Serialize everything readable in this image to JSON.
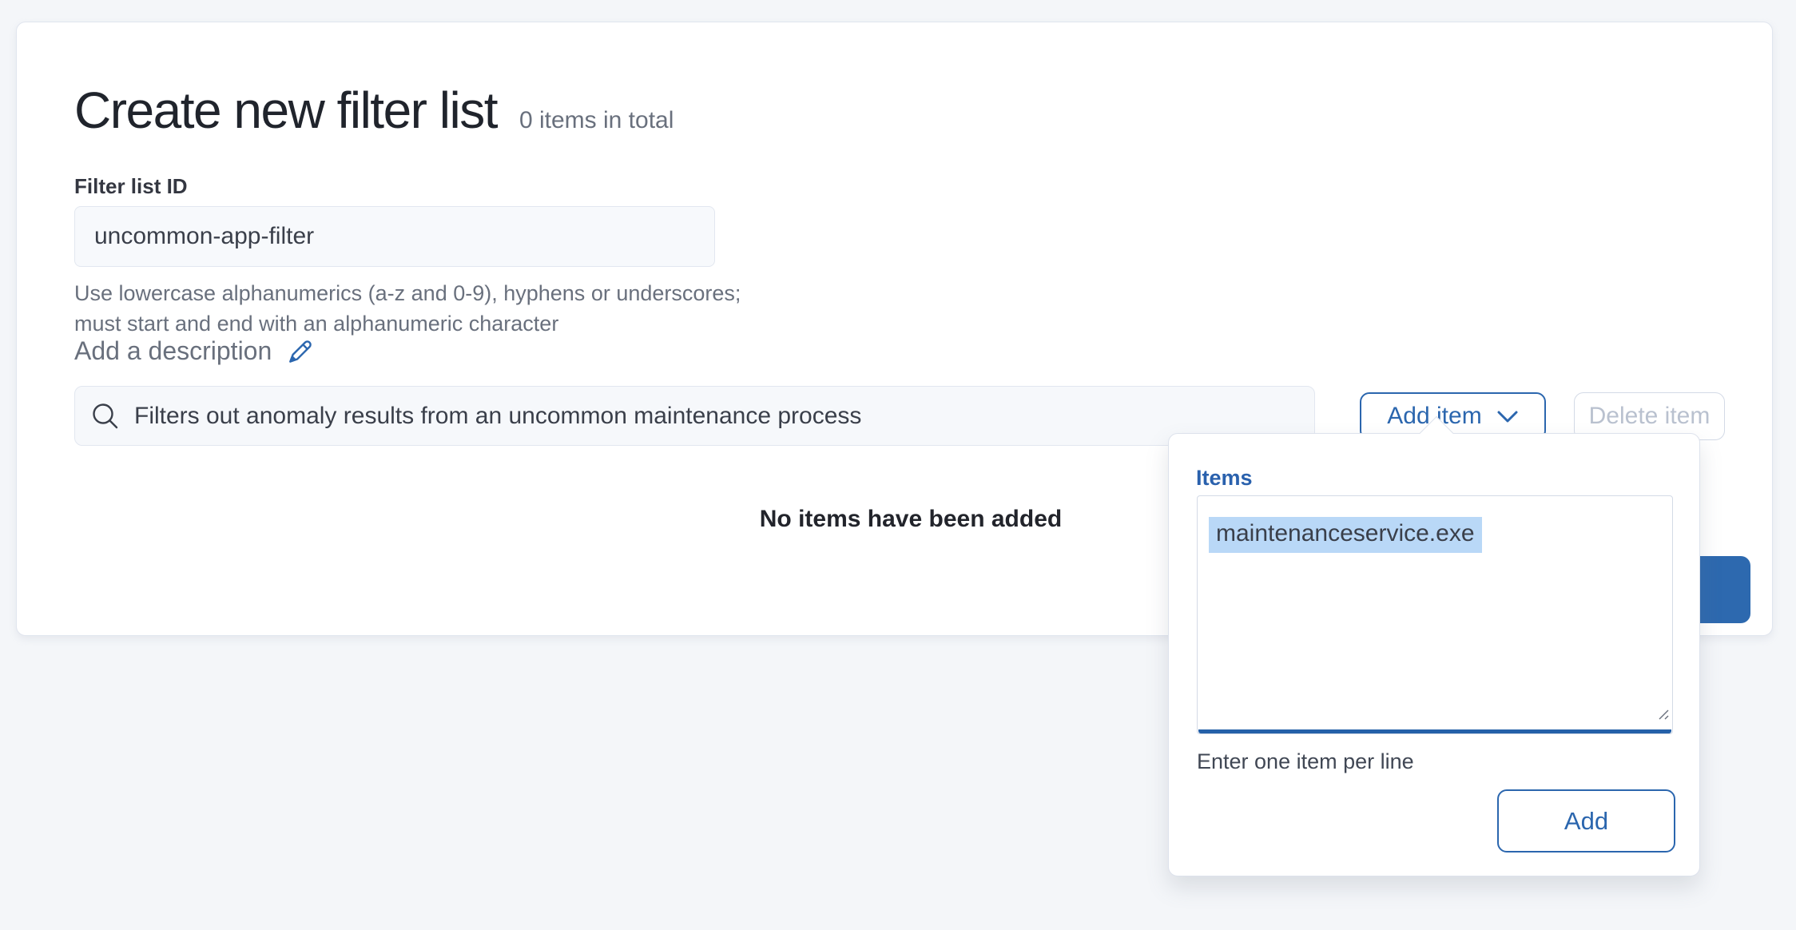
{
  "header": {
    "title": "Create new filter list",
    "count": "0 items in total"
  },
  "id_field": {
    "label": "Filter list ID",
    "value": "uncommon-app-filter",
    "help": "Use lowercase alphanumerics (a-z and 0-9), hyphens or underscores; must start and end with an alphanumeric character"
  },
  "description": {
    "link": "Add a description"
  },
  "toolbar": {
    "search_value": "Filters out anomaly results from an uncommon maintenance process",
    "add_item": "Add item",
    "delete_item": "Delete item"
  },
  "content": {
    "empty": "No items have been added"
  },
  "popover": {
    "title": "Items",
    "value": "maintenanceservice.exe",
    "help": "Enter one item per line",
    "add": "Add"
  },
  "icons": {
    "search": "search-icon",
    "pencil": "pencil-icon",
    "chevron": "chevron-down-icon",
    "resize": "resize-handle-icon"
  },
  "colors": {
    "primary": "#2b66ae",
    "primary_fill": "#2d69af",
    "selection_highlight": "#b9d8f7",
    "text": "#343741",
    "subdued_text": "#69707d",
    "disabled_text": "#b9c1cf",
    "page_background": "#f4f6f9",
    "field_background": "#f6f8fb"
  }
}
